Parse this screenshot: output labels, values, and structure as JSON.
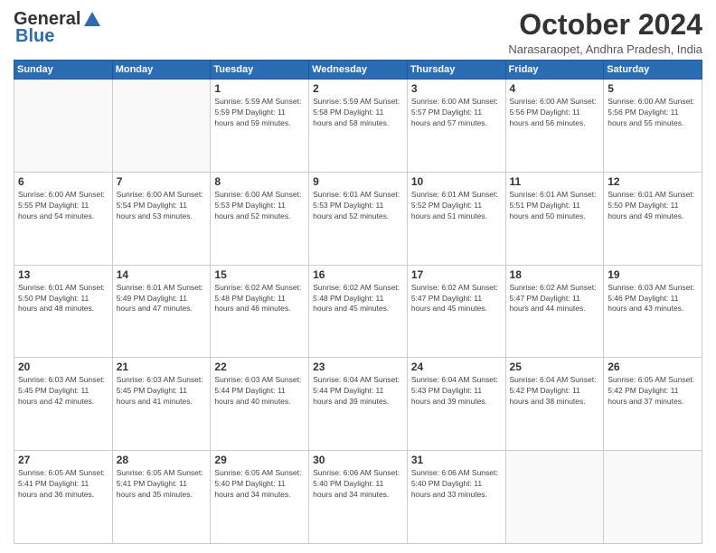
{
  "logo": {
    "general": "General",
    "blue": "Blue"
  },
  "header": {
    "month": "October 2024",
    "location": "Narasaraopet, Andhra Pradesh, India"
  },
  "weekdays": [
    "Sunday",
    "Monday",
    "Tuesday",
    "Wednesday",
    "Thursday",
    "Friday",
    "Saturday"
  ],
  "weeks": [
    [
      {
        "day": "",
        "info": ""
      },
      {
        "day": "",
        "info": ""
      },
      {
        "day": "1",
        "info": "Sunrise: 5:59 AM\nSunset: 5:59 PM\nDaylight: 11 hours\nand 59 minutes."
      },
      {
        "day": "2",
        "info": "Sunrise: 5:59 AM\nSunset: 5:58 PM\nDaylight: 11 hours\nand 58 minutes."
      },
      {
        "day": "3",
        "info": "Sunrise: 6:00 AM\nSunset: 5:57 PM\nDaylight: 11 hours\nand 57 minutes."
      },
      {
        "day": "4",
        "info": "Sunrise: 6:00 AM\nSunset: 5:56 PM\nDaylight: 11 hours\nand 56 minutes."
      },
      {
        "day": "5",
        "info": "Sunrise: 6:00 AM\nSunset: 5:56 PM\nDaylight: 11 hours\nand 55 minutes."
      }
    ],
    [
      {
        "day": "6",
        "info": "Sunrise: 6:00 AM\nSunset: 5:55 PM\nDaylight: 11 hours\nand 54 minutes."
      },
      {
        "day": "7",
        "info": "Sunrise: 6:00 AM\nSunset: 5:54 PM\nDaylight: 11 hours\nand 53 minutes."
      },
      {
        "day": "8",
        "info": "Sunrise: 6:00 AM\nSunset: 5:53 PM\nDaylight: 11 hours\nand 52 minutes."
      },
      {
        "day": "9",
        "info": "Sunrise: 6:01 AM\nSunset: 5:53 PM\nDaylight: 11 hours\nand 52 minutes."
      },
      {
        "day": "10",
        "info": "Sunrise: 6:01 AM\nSunset: 5:52 PM\nDaylight: 11 hours\nand 51 minutes."
      },
      {
        "day": "11",
        "info": "Sunrise: 6:01 AM\nSunset: 5:51 PM\nDaylight: 11 hours\nand 50 minutes."
      },
      {
        "day": "12",
        "info": "Sunrise: 6:01 AM\nSunset: 5:50 PM\nDaylight: 11 hours\nand 49 minutes."
      }
    ],
    [
      {
        "day": "13",
        "info": "Sunrise: 6:01 AM\nSunset: 5:50 PM\nDaylight: 11 hours\nand 48 minutes."
      },
      {
        "day": "14",
        "info": "Sunrise: 6:01 AM\nSunset: 5:49 PM\nDaylight: 11 hours\nand 47 minutes."
      },
      {
        "day": "15",
        "info": "Sunrise: 6:02 AM\nSunset: 5:48 PM\nDaylight: 11 hours\nand 46 minutes."
      },
      {
        "day": "16",
        "info": "Sunrise: 6:02 AM\nSunset: 5:48 PM\nDaylight: 11 hours\nand 45 minutes."
      },
      {
        "day": "17",
        "info": "Sunrise: 6:02 AM\nSunset: 5:47 PM\nDaylight: 11 hours\nand 45 minutes."
      },
      {
        "day": "18",
        "info": "Sunrise: 6:02 AM\nSunset: 5:47 PM\nDaylight: 11 hours\nand 44 minutes."
      },
      {
        "day": "19",
        "info": "Sunrise: 6:03 AM\nSunset: 5:46 PM\nDaylight: 11 hours\nand 43 minutes."
      }
    ],
    [
      {
        "day": "20",
        "info": "Sunrise: 6:03 AM\nSunset: 5:45 PM\nDaylight: 11 hours\nand 42 minutes."
      },
      {
        "day": "21",
        "info": "Sunrise: 6:03 AM\nSunset: 5:45 PM\nDaylight: 11 hours\nand 41 minutes."
      },
      {
        "day": "22",
        "info": "Sunrise: 6:03 AM\nSunset: 5:44 PM\nDaylight: 11 hours\nand 40 minutes."
      },
      {
        "day": "23",
        "info": "Sunrise: 6:04 AM\nSunset: 5:44 PM\nDaylight: 11 hours\nand 39 minutes."
      },
      {
        "day": "24",
        "info": "Sunrise: 6:04 AM\nSunset: 5:43 PM\nDaylight: 11 hours\nand 39 minutes."
      },
      {
        "day": "25",
        "info": "Sunrise: 6:04 AM\nSunset: 5:42 PM\nDaylight: 11 hours\nand 38 minutes."
      },
      {
        "day": "26",
        "info": "Sunrise: 6:05 AM\nSunset: 5:42 PM\nDaylight: 11 hours\nand 37 minutes."
      }
    ],
    [
      {
        "day": "27",
        "info": "Sunrise: 6:05 AM\nSunset: 5:41 PM\nDaylight: 11 hours\nand 36 minutes."
      },
      {
        "day": "28",
        "info": "Sunrise: 6:05 AM\nSunset: 5:41 PM\nDaylight: 11 hours\nand 35 minutes."
      },
      {
        "day": "29",
        "info": "Sunrise: 6:05 AM\nSunset: 5:40 PM\nDaylight: 11 hours\nand 34 minutes."
      },
      {
        "day": "30",
        "info": "Sunrise: 6:06 AM\nSunset: 5:40 PM\nDaylight: 11 hours\nand 34 minutes."
      },
      {
        "day": "31",
        "info": "Sunrise: 6:06 AM\nSunset: 5:40 PM\nDaylight: 11 hours\nand 33 minutes."
      },
      {
        "day": "",
        "info": ""
      },
      {
        "day": "",
        "info": ""
      }
    ]
  ]
}
